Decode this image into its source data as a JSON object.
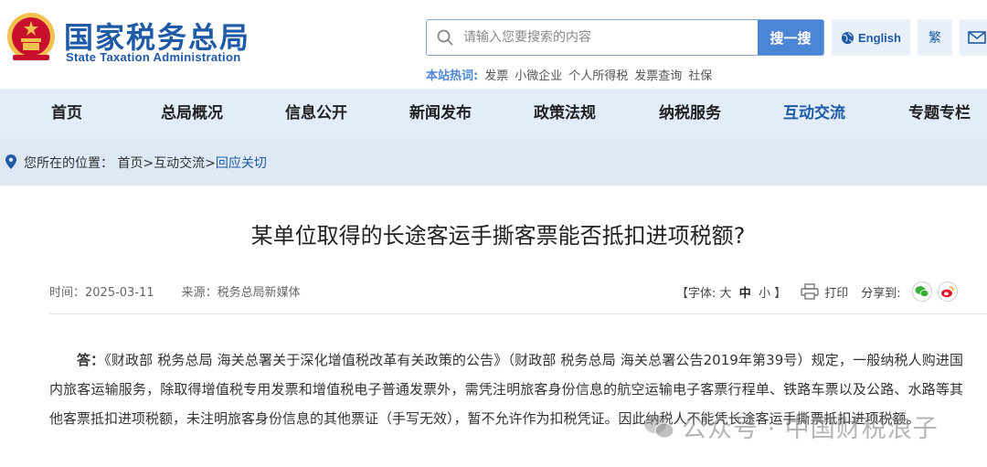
{
  "header": {
    "logo_cn": "国家税务总局",
    "logo_en": "State Taxation Administration",
    "search": {
      "placeholder": "请输入您要搜索的内容",
      "button": "搜一搜"
    },
    "lang_label": "English",
    "trad_label": "繁",
    "hot_label": "本站热词:",
    "hot_words": [
      "发票",
      "小微企业",
      "个人所得税",
      "发票查询",
      "社保"
    ]
  },
  "nav": {
    "items": [
      "首页",
      "总局概况",
      "信息公开",
      "新闻发布",
      "政策法规",
      "纳税服务",
      "互动交流",
      "专题专栏"
    ],
    "active_index": 6
  },
  "breadcrumb": {
    "prefix": "您所在的位置：",
    "home": "首页",
    "sep1": ">",
    "section": "互动交流",
    "sep2": ">",
    "current": "回应关切"
  },
  "article": {
    "title": "某单位取得的长途客运手撕客票能否抵扣进项税额?",
    "time_label": "时间：2025-03-11",
    "source_label": "来源：税务总局新媒体",
    "font_prefix": "【字体: ",
    "font_large": "大",
    "font_mid": "中",
    "font_small": "小",
    "font_suffix": " 】",
    "print_label": "打印",
    "share_label": "分享到:",
    "answer_label": "答：",
    "answer_text": "《财政部 税务总局 海关总署关于深化增值税改革有关政策的公告》（财政部 税务总局 海关总署公告2019年第39号）规定，一般纳税人购进国内旅客运输服务，除取得增值税专用发票和增值税电子普通发票外，需凭注明旅客身份信息的航空运输电子客票行程单、铁路车票以及公路、水路等其他客票抵扣进项税额，未注明旅客身份信息的其他票证（手写无效），暂不允许作为扣税凭证。因此纳税人不能凭长途客运手撕票抵扣进项税额。"
  },
  "watermark": {
    "text": "公众号 · 中国财税浪子"
  },
  "colors": {
    "brand": "#1f5aa6",
    "nav_bg": "#e3edf9",
    "button": "#4b86d6",
    "emblem_red": "#c8102e",
    "emblem_gold": "#f2c14e"
  }
}
